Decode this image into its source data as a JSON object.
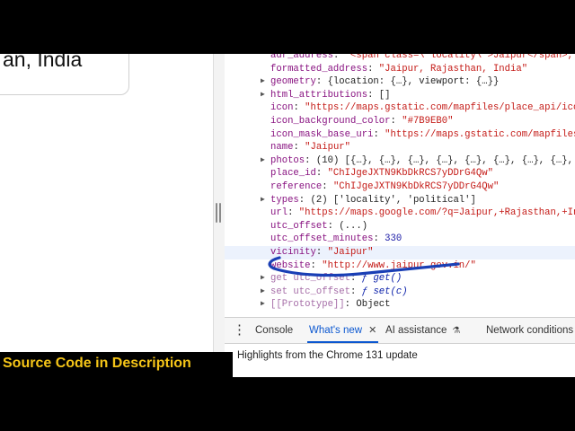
{
  "place_card": {
    "text": "an, India"
  },
  "devtools": {
    "properties": [
      {
        "key": "adr_address",
        "sep": ": ",
        "value": "\"<span class=\\\"locality\\\">Jaipur</span>, <s",
        "vclass": "s",
        "twisty": ""
      },
      {
        "key": "formatted_address",
        "sep": ": ",
        "value": "\"Jaipur, Rajasthan, India\"",
        "vclass": "s",
        "twisty": ""
      },
      {
        "key": "geometry",
        "sep": ": ",
        "value": "{location: {…}, viewport: {…}}",
        "vclass": "p",
        "twisty": "▶"
      },
      {
        "key": "html_attributions",
        "sep": ": ",
        "value": "[]",
        "vclass": "p",
        "twisty": "▶"
      },
      {
        "key": "icon",
        "sep": ": ",
        "value": "\"https://maps.gstatic.com/mapfiles/place_api/icons",
        "vclass": "s",
        "twisty": ""
      },
      {
        "key": "icon_background_color",
        "sep": ": ",
        "value": "\"#7B9EB0\"",
        "vclass": "s",
        "twisty": ""
      },
      {
        "key": "icon_mask_base_uri",
        "sep": ": ",
        "value": "\"https://maps.gstatic.com/mapfiles/p",
        "vclass": "s",
        "twisty": ""
      },
      {
        "key": "name",
        "sep": ": ",
        "value": "\"Jaipur\"",
        "vclass": "s",
        "twisty": ""
      },
      {
        "key": "photos",
        "sep": ": ",
        "value": "(10) [{…}, {…}, {…}, {…}, {…}, {…}, {…}, {…}, {…",
        "vclass": "p",
        "twisty": "▶"
      },
      {
        "key": "place_id",
        "sep": ": ",
        "value": "\"ChIJgeJXTN9KbDkRCS7yDDrG4Qw\"",
        "vclass": "s",
        "twisty": ""
      },
      {
        "key": "reference",
        "sep": ": ",
        "value": "\"ChIJgeJXTN9KbDkRCS7yDDrG4Qw\"",
        "vclass": "s",
        "twisty": ""
      },
      {
        "key": "types",
        "sep": ": ",
        "value": "(2) ['locality', 'political']",
        "vclass": "p",
        "twisty": "▶"
      },
      {
        "key": "url",
        "sep": ": ",
        "value": "\"https://maps.google.com/?q=Jaipur,+Rajasthan,+Indi",
        "vclass": "s",
        "twisty": ""
      },
      {
        "key": "utc_offset",
        "sep": ": ",
        "value": "(...)",
        "vclass": "p",
        "twisty": ""
      },
      {
        "key": "utc_offset_minutes",
        "sep": ": ",
        "value": "330",
        "vclass": "n",
        "twisty": ""
      },
      {
        "key": "vicinity",
        "sep": ": ",
        "value": "\"Jaipur\"",
        "vclass": "s",
        "twisty": ""
      },
      {
        "key": "website",
        "sep": ": ",
        "value": "\"http://www.jaipur.gov.in/\"",
        "vclass": "s",
        "twisty": ""
      },
      {
        "key": "get utc_offset",
        "sep": ": ",
        "value": "ƒ get()",
        "vclass": "fn",
        "twisty": "▶",
        "kclass": "dim"
      },
      {
        "key": "set utc_offset",
        "sep": ": ",
        "value": "ƒ set(c)",
        "vclass": "fn",
        "twisty": "▶",
        "kclass": "dim"
      },
      {
        "key": "[[Prototype]]",
        "sep": ": ",
        "value": "Object",
        "vclass": "p",
        "twisty": "▶",
        "kclass": "dim"
      }
    ]
  },
  "drawer": {
    "tabs": [
      {
        "label": "Console",
        "active": false
      },
      {
        "label": "What's new",
        "active": true,
        "close": "✕"
      },
      {
        "label": "AI assistance",
        "active": false,
        "badge": "⚗"
      },
      {
        "label": "Network conditions",
        "active": false
      }
    ],
    "body_text": "Highlights from the Chrome 131 update"
  },
  "banner": {
    "text": "Source Code in  Description"
  },
  "colors": {
    "annotation": "#1a3fb5",
    "banner_text": "#f5c518",
    "active_tab": "#0b57d0",
    "key": "#881280",
    "string": "#c41a16",
    "number": "#1a1aa6"
  },
  "icons": {
    "menu": "more-vert-icon",
    "close": "close-icon",
    "flask": "flask-icon",
    "expand": "triangle-right-icon"
  }
}
